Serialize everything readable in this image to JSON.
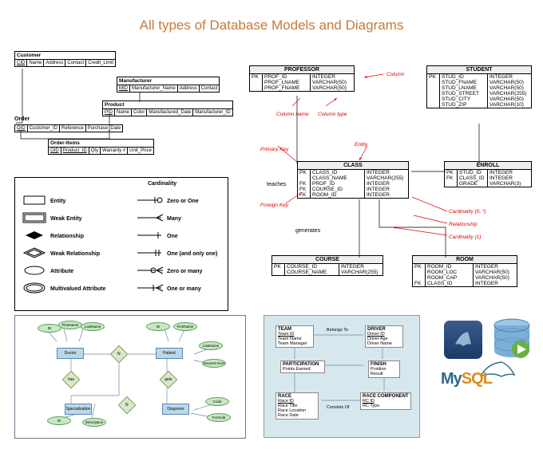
{
  "title": "All types of Database Models and Diagrams",
  "topLeft": {
    "customer": {
      "name": "Customer",
      "cols": [
        "CID",
        "Name",
        "Address",
        "Contact",
        "Credit_Limit"
      ]
    },
    "order": {
      "name": "Order",
      "cols": [
        "OID",
        "Customer_ID",
        "Reference",
        "Purchase_Date"
      ]
    },
    "manufacturer": {
      "name": "Manufacturer",
      "cols": [
        "MID",
        "Manufacturer_Name",
        "Address",
        "Contact"
      ]
    },
    "product": {
      "name": "Product",
      "cols": [
        "PID",
        "Name",
        "Color",
        "Manufactured_Date",
        "Manufacturer_ID"
      ]
    },
    "orderItems": {
      "name": "Order-Items",
      "cols": [
        "OID",
        "Product_ID",
        "Qty",
        "Warranty #",
        "Unit_Price"
      ]
    }
  },
  "physical": {
    "professor": {
      "name": "PROFESSOR",
      "rows": [
        {
          "k": "PK",
          "n": "PROF_ID",
          "t": "INTEGER"
        },
        {
          "k": "",
          "n": "PROF_LNAME",
          "t": "VARCHAR(50)"
        },
        {
          "k": "",
          "n": "PROF_FNAME",
          "t": "VARCHAR(50)"
        }
      ]
    },
    "student": {
      "name": "STUDENT",
      "rows": [
        {
          "k": "PK",
          "n": "STUD_ID",
          "t": "INTEGER"
        },
        {
          "k": "",
          "n": "STUD_FNAME",
          "t": "VARCHAR(50)"
        },
        {
          "k": "",
          "n": "STUD_LNAME",
          "t": "VARCHAR(50)"
        },
        {
          "k": "",
          "n": "STUD_STREET",
          "t": "VARCHAR(255)"
        },
        {
          "k": "",
          "n": "STUD_CITY",
          "t": "VARCHAR(50)"
        },
        {
          "k": "",
          "n": "STUD_ZIP",
          "t": "VARCHAR(10)"
        }
      ]
    },
    "class": {
      "name": "CLASS",
      "rows": [
        {
          "k": "PK",
          "n": "CLASS_ID",
          "t": "INTEGER"
        },
        {
          "k": "",
          "n": "CLASS_NAME",
          "t": "VARCHAR(255)"
        },
        {
          "k": "FK",
          "n": "PROF_ID",
          "t": "INTEGER"
        },
        {
          "k": "FK",
          "n": "COURSE_ID",
          "t": "INTEGER"
        },
        {
          "k": "FK",
          "n": "ROOM_ID",
          "t": "INTEGER"
        }
      ]
    },
    "enroll": {
      "name": "ENROLL",
      "rows": [
        {
          "k": "PK",
          "n": "STUD_ID",
          "t": "INTEGER"
        },
        {
          "k": "FK",
          "n": "CLASS_ID",
          "t": "INTEGER"
        },
        {
          "k": "",
          "n": "GRADE",
          "t": "VARCHAR(3)"
        }
      ]
    },
    "course": {
      "name": "COURSE",
      "rows": [
        {
          "k": "PK",
          "n": "COURSE_ID",
          "t": "INTEGER"
        },
        {
          "k": "",
          "n": "COURSE_NAME",
          "t": "VARCHAR(255)"
        }
      ]
    },
    "room": {
      "name": "ROOM",
      "rows": [
        {
          "k": "PK",
          "n": "ROOM_ID",
          "t": "INTEGER"
        },
        {
          "k": "",
          "n": "ROOM_LOC",
          "t": "VARCHAR(50)"
        },
        {
          "k": "",
          "n": "ROOM_CAP",
          "t": "VARCHAR(50)"
        },
        {
          "k": "FK",
          "n": "CLASS_ID",
          "t": "INTEGER"
        }
      ]
    },
    "labels": {
      "column": "Column",
      "columnName": "Column name",
      "columnType": "Column type",
      "primaryKey": "Primary Key",
      "entity": "Entity",
      "foreignKey": "Foreign Key",
      "teaches": "teaches",
      "generates": "generates",
      "cardinalityMany": "Cardinality (0..*)",
      "relationship": "Relationship",
      "cardinalityOne": "Cardinality (1)"
    }
  },
  "legend": {
    "heading": "Cardinality",
    "left": [
      "Entity",
      "Weak Entity",
      "Relationship",
      "Weak Relationship",
      "Attribute",
      "Multivalued Attribute"
    ],
    "right": [
      "Zero or One",
      "Many",
      "One",
      "One (and only one)",
      "Zero or many",
      "One or many"
    ]
  },
  "erDiagram": {
    "entities": [
      "Doctor",
      "Patient",
      "Specialization",
      "Diagnose"
    ],
    "attrs": [
      "ID",
      "FirstName",
      "LastName",
      "ID",
      "FirstName",
      "LastName",
      "Insurent Num",
      "Code",
      "Formula",
      "ID",
      "Description"
    ],
    "rels": [
      "N",
      "N",
      "N",
      "gets",
      "has"
    ]
  },
  "blueDiagram": {
    "team": {
      "h": "TEAM",
      "f": [
        "Team ID",
        "Team Name",
        "Team Manager"
      ]
    },
    "driver": {
      "h": "DRIVER",
      "f": [
        "Driver ID",
        "Driver Age",
        "Driver Name"
      ]
    },
    "participation": {
      "h": "PARTICIPATION",
      "f": [
        "Points Earned"
      ]
    },
    "finish": {
      "h": "FINISH",
      "f": [
        "Position",
        "Result"
      ]
    },
    "race": {
      "h": "RACE",
      "f": [
        "Race ID",
        "Race Title",
        "Race Location",
        "Race Date"
      ]
    },
    "raceComponent": {
      "h": "RACE COMPONENT",
      "f": [
        "RC ID",
        "RC Type"
      ]
    },
    "rels": [
      "Belongs To",
      "Consists Of"
    ]
  },
  "mysql": {
    "label": "MySQL"
  }
}
